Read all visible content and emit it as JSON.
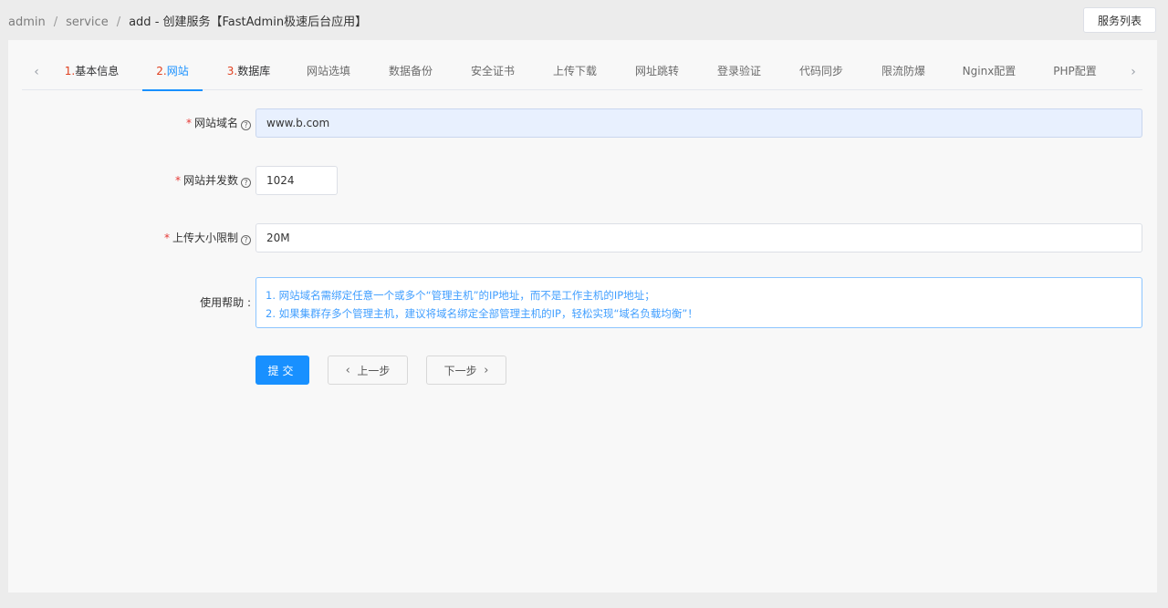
{
  "breadcrumb": {
    "items": [
      "admin",
      "service"
    ],
    "current": "add - 创建服务【FastAdmin极速后台应用】",
    "separator": "/"
  },
  "header": {
    "list_button": "服务列表"
  },
  "tabs": {
    "prev_icon": "chevron-left-icon",
    "next_icon": "chevron-right-icon",
    "items": [
      {
        "num": "1.",
        "label": "基本信息"
      },
      {
        "num": "2.",
        "label": "网站"
      },
      {
        "num": "3.",
        "label": "数据库"
      },
      {
        "label": "网站选填"
      },
      {
        "label": "数据备份"
      },
      {
        "label": "安全证书"
      },
      {
        "label": "上传下载"
      },
      {
        "label": "网址跳转"
      },
      {
        "label": "登录验证"
      },
      {
        "label": "代码同步"
      },
      {
        "label": "限流防爆"
      },
      {
        "label": "Nginx配置"
      },
      {
        "label": "PHP配置"
      }
    ],
    "active_index": 1
  },
  "form": {
    "domain": {
      "required": "*",
      "label": "网站域名",
      "value": "www.b.com"
    },
    "concurrency": {
      "required": "*",
      "label": "网站并发数",
      "value": "1024"
    },
    "upload_limit": {
      "required": "*",
      "label": "上传大小限制",
      "value": "20M"
    },
    "help": {
      "label": "使用帮助 :",
      "lines": [
        "1. 网站域名需绑定任意一个或多个“管理主机”的IP地址，而不是工作主机的IP地址；",
        "2. 如果集群存多个管理主机，建议将域名绑定全部管理主机的IP，轻松实现“域名负载均衡”！"
      ]
    }
  },
  "buttons": {
    "submit": "提交",
    "prev": "上一步",
    "next": "下一步"
  },
  "colors": {
    "primary": "#1890ff",
    "required": "#e53935",
    "step_number": "#e0401f",
    "help_text": "#409eff"
  }
}
